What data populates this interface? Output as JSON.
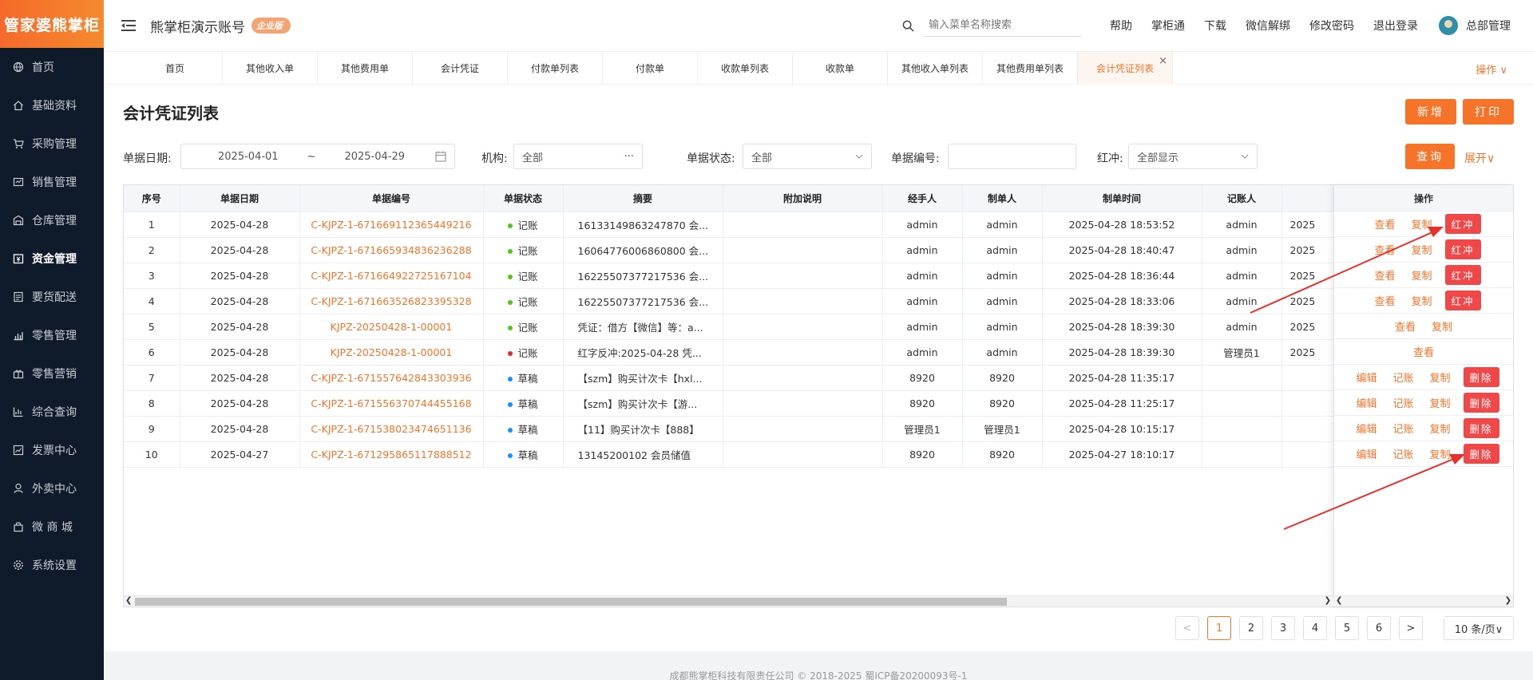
{
  "logo": "管家婆熊掌柜",
  "sidebar": {
    "items": [
      {
        "label": "首页",
        "icon": "globe-icon"
      },
      {
        "label": "基础资料",
        "icon": "home-icon"
      },
      {
        "label": "采购管理",
        "icon": "cart-icon"
      },
      {
        "label": "销售管理",
        "icon": "sales-icon"
      },
      {
        "label": "仓库管理",
        "icon": "warehouse-icon"
      },
      {
        "label": "资金管理",
        "icon": "money-icon"
      },
      {
        "label": "要货配送",
        "icon": "list-icon"
      },
      {
        "label": "零售管理",
        "icon": "chart-icon"
      },
      {
        "label": "零售营销",
        "icon": "gift-icon"
      },
      {
        "label": "综合查询",
        "icon": "bar-chart-icon"
      },
      {
        "label": "发票中心",
        "icon": "trend-icon"
      },
      {
        "label": "外卖中心",
        "icon": "delivery-icon"
      },
      {
        "label": "微 商 城",
        "icon": "shop-icon"
      },
      {
        "label": "系统设置",
        "icon": "gear-icon"
      }
    ],
    "active_index": 5
  },
  "header": {
    "account": "熊掌柜演示账号",
    "edition_badge": "企业版",
    "search_placeholder": "输入菜单名称搜索",
    "links": [
      "帮助",
      "掌柜通",
      "下载",
      "微信解绑",
      "修改密码",
      "退出登录"
    ],
    "user": "总部管理"
  },
  "tabs": {
    "items": [
      "首页",
      "其他收入单",
      "其他费用单",
      "会计凭证",
      "付款单列表",
      "付款单",
      "收款单列表",
      "收款单",
      "其他收入单列表",
      "其他费用单列表",
      "会计凭证列表"
    ],
    "active_index": 10,
    "ops": "操作 ∨"
  },
  "page": {
    "title": "会计凭证列表",
    "add_button": "新增",
    "print_button": "打印"
  },
  "filters": {
    "date_label": "单据日期:",
    "date_from": "2025-04-01",
    "date_sep": "~",
    "date_to": "2025-04-29",
    "org_label": "机构:",
    "org_value": "全部",
    "org_more": "···",
    "status_label": "单据状态:",
    "status_value": "全部",
    "code_label": "单据编号:",
    "code_value": "",
    "redflush_label": "红冲:",
    "redflush_value": "全部显示",
    "query_button": "查询",
    "expand_link": "展开∨"
  },
  "table": {
    "columns": [
      "序号",
      "单据日期",
      "单据编号",
      "单据状态",
      "摘要",
      "附加说明",
      "经手人",
      "制单人",
      "制单时间",
      "记账人",
      ""
    ],
    "op_header": "操作",
    "rows": [
      {
        "no": "1",
        "date": "2025-04-28",
        "code": "C-KJPZ-1-671669112365449216",
        "status": "记账",
        "status_color": "#52c41a",
        "summary": "16133149863247870 会...",
        "note": "",
        "handler": "admin",
        "maker": "admin",
        "made_at": "2025-04-28 18:53:52",
        "poster": "admin",
        "extra": "2025",
        "ops": [
          "查看",
          "复制"
        ],
        "btn": "红冲"
      },
      {
        "no": "2",
        "date": "2025-04-28",
        "code": "C-KJPZ-1-671665934836236288",
        "status": "记账",
        "status_color": "#52c41a",
        "summary": "16064776006860800 会...",
        "note": "",
        "handler": "admin",
        "maker": "admin",
        "made_at": "2025-04-28 18:40:47",
        "poster": "admin",
        "extra": "2025",
        "ops": [
          "查看",
          "复制"
        ],
        "btn": "红冲"
      },
      {
        "no": "3",
        "date": "2025-04-28",
        "code": "C-KJPZ-1-671664922725167104",
        "status": "记账",
        "status_color": "#52c41a",
        "summary": "16225507377217536 会...",
        "note": "",
        "handler": "admin",
        "maker": "admin",
        "made_at": "2025-04-28 18:36:44",
        "poster": "admin",
        "extra": "2025",
        "ops": [
          "查看",
          "复制"
        ],
        "btn": "红冲"
      },
      {
        "no": "4",
        "date": "2025-04-28",
        "code": "C-KJPZ-1-671663526823395328",
        "status": "记账",
        "status_color": "#52c41a",
        "summary": "16225507377217536 会...",
        "note": "",
        "handler": "admin",
        "maker": "admin",
        "made_at": "2025-04-28 18:33:06",
        "poster": "admin",
        "extra": "2025",
        "ops": [
          "查看",
          "复制"
        ],
        "btn": "红冲"
      },
      {
        "no": "5",
        "date": "2025-04-28",
        "code": "KJPZ-20250428-1-00001",
        "status": "记账",
        "status_color": "#52c41a",
        "summary": "凭证：借方【微信】等：a...",
        "note": "",
        "handler": "admin",
        "maker": "admin",
        "made_at": "2025-04-28 18:39:30",
        "poster": "admin",
        "extra": "2025",
        "ops": [
          "查看",
          "复制"
        ],
        "btn": ""
      },
      {
        "no": "6",
        "date": "2025-04-28",
        "code": "KJPZ-20250428-1-00001",
        "status": "记账",
        "status_color": "#e02828",
        "summary": "红字反冲:2025-04-28 凭...",
        "note": "",
        "handler": "admin",
        "maker": "admin",
        "made_at": "2025-04-28 18:39:30",
        "poster": "管理员1",
        "extra": "2025",
        "ops": [
          "查看"
        ],
        "btn": ""
      },
      {
        "no": "7",
        "date": "2025-04-28",
        "code": "C-KJPZ-1-671557642843303936",
        "status": "草稿",
        "status_color": "#1890ff",
        "summary": "【szm】购买计次卡【hxl...",
        "note": "",
        "handler": "8920",
        "maker": "8920",
        "made_at": "2025-04-28 11:35:17",
        "poster": "",
        "extra": "",
        "ops": [
          "编辑",
          "记账",
          "复制"
        ],
        "btn": "删除"
      },
      {
        "no": "8",
        "date": "2025-04-28",
        "code": "C-KJPZ-1-671556370744455168",
        "status": "草稿",
        "status_color": "#1890ff",
        "summary": "【szm】购买计次卡【游...",
        "note": "",
        "handler": "8920",
        "maker": "8920",
        "made_at": "2025-04-28 11:25:17",
        "poster": "",
        "extra": "",
        "ops": [
          "编辑",
          "记账",
          "复制"
        ],
        "btn": "删除"
      },
      {
        "no": "9",
        "date": "2025-04-28",
        "code": "C-KJPZ-1-671538023474651136",
        "status": "草稿",
        "status_color": "#1890ff",
        "summary": "【11】购买计次卡【888】",
        "note": "",
        "handler": "管理员1",
        "maker": "管理员1",
        "made_at": "2025-04-28 10:15:17",
        "poster": "",
        "extra": "",
        "ops": [
          "编辑",
          "记账",
          "复制"
        ],
        "btn": "删除"
      },
      {
        "no": "10",
        "date": "2025-04-27",
        "code": "C-KJPZ-1-671295865117888512",
        "status": "草稿",
        "status_color": "#1890ff",
        "summary": "13145200102 会员储值",
        "note": "",
        "handler": "8920",
        "maker": "8920",
        "made_at": "2025-04-27 18:10:17",
        "poster": "",
        "extra": "",
        "ops": [
          "编辑",
          "记账",
          "复制"
        ],
        "btn": "删除"
      }
    ]
  },
  "pagination": {
    "prev": "<",
    "pages": [
      "1",
      "2",
      "3",
      "4",
      "5",
      "6"
    ],
    "current": "1",
    "next": ">",
    "page_size": "10 条/页∨"
  },
  "footer": "成都熊掌柜科技有限责任公司 © 2018-2025 蜀ICP备20200093号-1",
  "colors": {
    "accent": "#f5742a",
    "danger": "#f04848",
    "sidebar_bg": "#0f1b2b"
  }
}
